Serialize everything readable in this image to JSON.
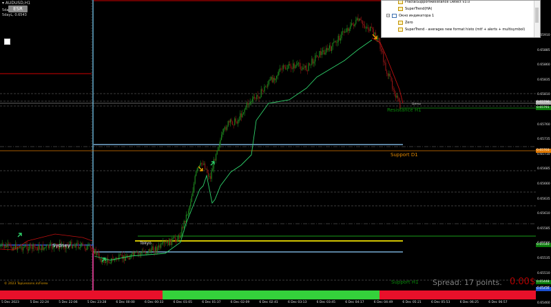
{
  "window": {
    "symbol_title": "AUDUSD,H1",
    "info_line_1": "5dayH, 0.6667",
    "info_line_2": "5dayL, 0.6543",
    "badge_label": "ESR",
    "copyright": "© 2023 TopLessons.in/Forex"
  },
  "sessions": {
    "sydney": "Sydney",
    "tokyo": "Tokyo"
  },
  "levels": {
    "resistance_h1": "Resistance H1",
    "support_d1": "Support D1",
    "support_h1": "Support H1",
    "price_label": "Цены"
  },
  "spread": {
    "label": "Spread: 17 points.",
    "value": "0.00$"
  },
  "price_axis": {
    "ticks": [
      "0.65910",
      "0.65885",
      "0.65860",
      "0.65835",
      "0.65810",
      "0.65785",
      "0.65760",
      "0.65735",
      "0.65710",
      "0.65685",
      "0.65660",
      "0.65635",
      "0.65610",
      "0.65585",
      "0.65560",
      "0.65535",
      "0.65510",
      "0.65485",
      "0.65460"
    ],
    "tags": [
      {
        "text": "0.65796",
        "color": "#b0b0b0"
      },
      {
        "text": "0.65791",
        "color": "#0a7a0a"
      },
      {
        "text": "0.65703",
        "color": "#e07800"
      },
      {
        "text": "0.65540",
        "color": "#0a7a0a"
      },
      {
        "text": "0.65448",
        "color": "#0a7a0a"
      },
      {
        "text": "0.65436",
        "color": "#1a4fd0"
      }
    ]
  },
  "time_axis": {
    "labels": [
      "5 Dec 2023",
      "5 Dec 22:24",
      "5 Dec 22:06",
      "5 Dec 23:28",
      "6 Dec 00:00",
      "6 Dec 00:33",
      "6 Dec 01:05",
      "6 Dec 01:37",
      "6 Dec 02:09",
      "6 Dec 02:41",
      "6 Dec 03:13",
      "6 Dec 03:45",
      "6 Dec 04:17",
      "6 Dec 04:49",
      "6 Dec 05:21",
      "6 Dec 05:53",
      "6 Dec 06:25",
      "6 Dec 06:57"
    ]
  },
  "session_bar": {
    "segments": [
      {
        "color": "#e8102a",
        "fraction": 0.303
      },
      {
        "color": "#34d13b",
        "fraction": 0.405
      },
      {
        "color": "#e8102a",
        "fraction": 0.045
      },
      {
        "color": "#34d13b",
        "fraction": 0.0
      },
      {
        "color": "#e8102a",
        "fraction": 0.247
      }
    ]
  },
  "navigator": {
    "items": [
      {
        "label": "FractalSupportResistance Detect v3.0",
        "kind": "ind",
        "indent": 1
      },
      {
        "label": "SuperTrend(HA)",
        "kind": "ind",
        "indent": 1
      },
      {
        "label": "Окно индикатора 1",
        "kind": "win",
        "indent": 0
      },
      {
        "label": "Zero",
        "kind": "ind",
        "indent": 1
      },
      {
        "label": "SuperTrend - averages new format histo  (mtf + alerts + multisymbol)",
        "kind": "ind",
        "indent": 1
      }
    ]
  },
  "colors": {
    "background": "#000000",
    "candles_up": "#1f8a1f",
    "candles_down": "#8b1414",
    "supertrend": "#2fd26b",
    "resistance_red": "#d00000",
    "support_orange": "#e07800",
    "level_blue": "#8fd0ff",
    "tokyo_yellow": "#f0e000",
    "session_green": "#1aa01a"
  }
}
